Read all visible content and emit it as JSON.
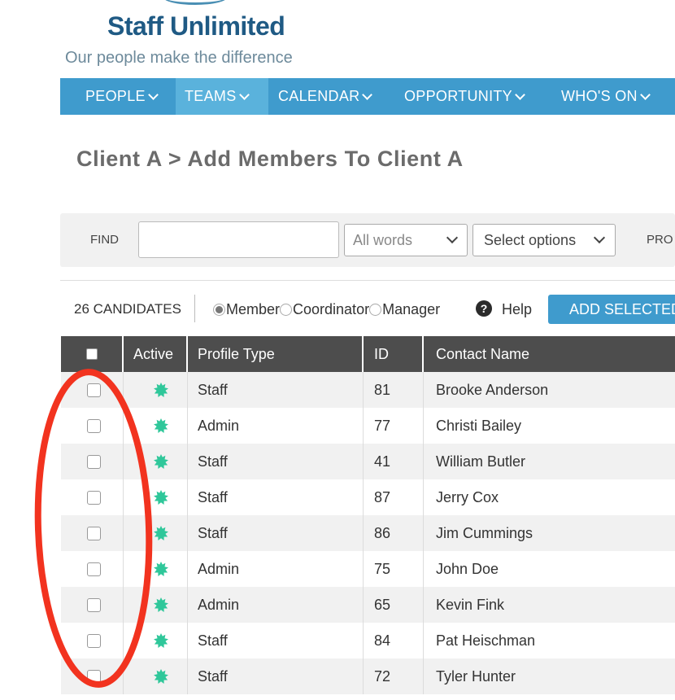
{
  "header": {
    "brand_name": "Staff Unlimited",
    "tagline": "Our people make the difference"
  },
  "nav": {
    "items": [
      {
        "label": "PEOPLE"
      },
      {
        "label": "TEAMS"
      },
      {
        "label": "CALENDAR"
      },
      {
        "label": "OPPORTUNITY"
      },
      {
        "label": "WHO'S ON"
      }
    ]
  },
  "page": {
    "title": "Client A > Add Members To Client A"
  },
  "find": {
    "label": "FIND",
    "input_value": "",
    "words_select": "All words",
    "options_select": "Select options",
    "cut_label": "PRO"
  },
  "toolbar": {
    "candidates": "26 CANDIDATES",
    "roles": [
      {
        "label": "Member",
        "selected": true
      },
      {
        "label": "Coordinator",
        "selected": false
      },
      {
        "label": "Manager",
        "selected": false
      }
    ],
    "help_label": "Help",
    "add_button": "ADD SELECTED"
  },
  "table": {
    "headers": {
      "active": "Active",
      "profile_type": "Profile Type",
      "id": "ID",
      "contact_name": "Contact Name"
    },
    "rows": [
      {
        "profile_type": "Staff",
        "id": "81",
        "name": "Brooke Anderson"
      },
      {
        "profile_type": "Admin",
        "id": "77",
        "name": "Christi Bailey"
      },
      {
        "profile_type": "Staff",
        "id": "41",
        "name": "William Butler"
      },
      {
        "profile_type": "Staff",
        "id": "87",
        "name": "Jerry Cox"
      },
      {
        "profile_type": "Staff",
        "id": "86",
        "name": "Jim Cummings"
      },
      {
        "profile_type": "Admin",
        "id": "75",
        "name": "John Doe"
      },
      {
        "profile_type": "Admin",
        "id": "65",
        "name": "Kevin Fink"
      },
      {
        "profile_type": "Staff",
        "id": "84",
        "name": "Pat Heischman"
      },
      {
        "profile_type": "Staff",
        "id": "72",
        "name": "Tyler Hunter"
      }
    ]
  },
  "colors": {
    "nav_bg": "#3f9bcd",
    "nav_active": "#5ab2dc",
    "table_header": "#4d4d4d",
    "active_dot": "#2fc79a",
    "annotation": "#f2331f"
  }
}
